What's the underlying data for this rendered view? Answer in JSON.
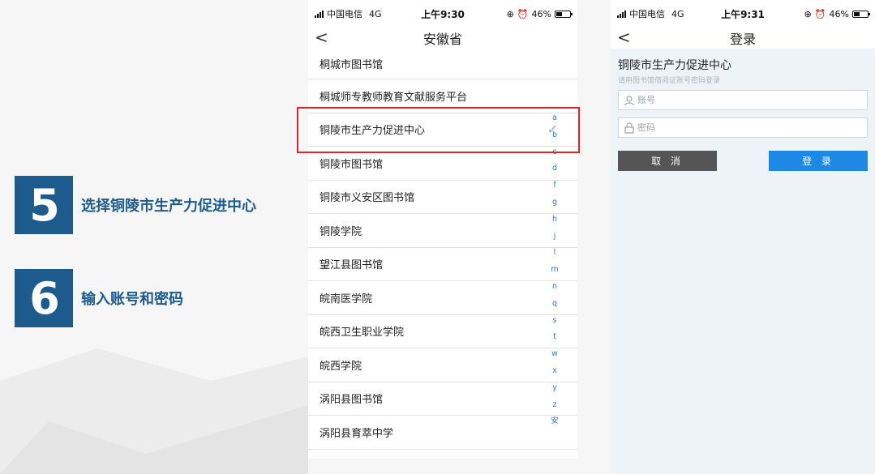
{
  "steps": [
    {
      "number": "5",
      "label": "选择铜陵市生产力促进中心"
    },
    {
      "number": "6",
      "label": "输入账号和密码"
    }
  ],
  "phone1": {
    "status": {
      "carrier": "中国电信",
      "network": "4G",
      "time": "上午9:30",
      "battery": "46%"
    },
    "nav": {
      "back_icon": "chevron-left-icon",
      "title": "安徽省"
    },
    "items": [
      "桐城市图书馆",
      "桐城师专教师教育文献服务平台",
      "铜陵市生产力促进中心",
      "铜陵市图书馆",
      "铜陵市义安区图书馆",
      "铜陵学院",
      "望江县图书馆",
      "皖南医学院",
      "皖西卫生职业学院",
      "皖西学院",
      "涡阳县图书馆",
      "涡阳县育萃中学"
    ],
    "selected_index": 2,
    "index_letters": [
      "a",
      "b",
      "c",
      "d",
      "f",
      "g",
      "h",
      "j",
      "l",
      "m",
      "n",
      "q",
      "s",
      "t",
      "w",
      "x",
      "y",
      "z",
      "安"
    ]
  },
  "phone2": {
    "status": {
      "carrier": "中国电信",
      "network": "4G",
      "time": "上午9:31",
      "battery": "46%"
    },
    "nav": {
      "back_icon": "chevron-left-icon",
      "title": "登录"
    },
    "org_name": "铜陵市生产力促进中心",
    "hint": "请用图书馆借阅证账号密码登录",
    "account_placeholder": "账号",
    "password_placeholder": "密码",
    "cancel_label": "取 消",
    "login_label": "登 录"
  },
  "colors": {
    "accent": "#1d5b8d",
    "highlight": "#e0262b",
    "login_button": "#1e88e5",
    "index": "#2a7bd8"
  }
}
